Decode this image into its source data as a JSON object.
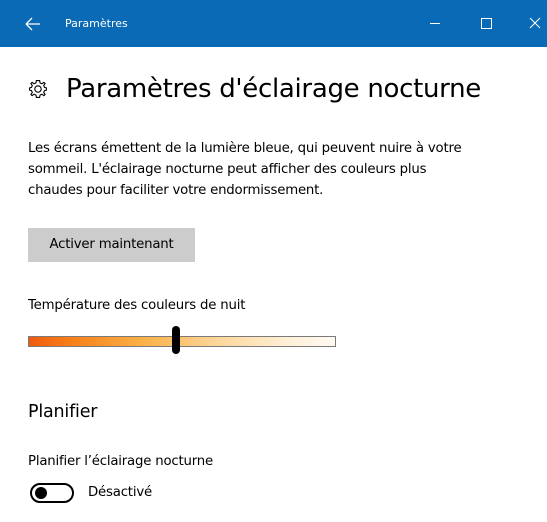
{
  "window": {
    "title": "Paramètres",
    "accent_color": "#0a6ab5"
  },
  "header": {
    "icon": "gear-icon",
    "title": "Paramètres d'éclairage nocturne"
  },
  "description": {
    "lines": [
      "Les écrans émettent de la lumière bleue, qui peuvent nuire à votre",
      "sommeil. L'éclairage nocturne peut afficher des couleurs plus",
      "chaudes pour faciliter votre endormissement."
    ]
  },
  "activate_button": {
    "label": "Activer maintenant"
  },
  "color_temperature": {
    "label": "Température des couleurs de nuit",
    "slider_value": 0.48
  },
  "schedule": {
    "heading": "Planifier",
    "toggle_label": "Planifier l’éclairage nocturne",
    "toggle_on": false,
    "toggle_state_text": "Désactivé"
  }
}
